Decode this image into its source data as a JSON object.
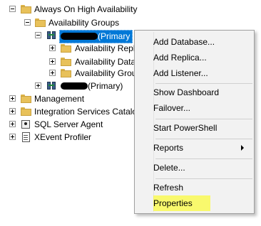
{
  "tree": {
    "always_on": "Always On High Availability",
    "availability_groups": "Availability Groups",
    "primary_group_suffix": "(Primary",
    "replicas": "Availability Repl",
    "databases": "Availability Data",
    "listeners": "Availability Grou",
    "second_group_suffix": "(Primary)",
    "management": "Management",
    "integration_services": "Integration Services Catalo",
    "sql_server_agent": "SQL Server Agent",
    "xevent_profiler": "XEvent Profiler"
  },
  "context_menu": {
    "add_database": "Add Database...",
    "add_replica": "Add Replica...",
    "add_listener": "Add Listener...",
    "show_dashboard": "Show Dashboard",
    "failover": "Failover...",
    "start_powershell": "Start PowerShell",
    "reports": "Reports",
    "delete": "Delete...",
    "refresh": "Refresh",
    "properties": "Properties"
  },
  "colors": {
    "selection": "#0078d7",
    "highlight": "#ffff00",
    "menu_background": "#f2f2f2"
  }
}
